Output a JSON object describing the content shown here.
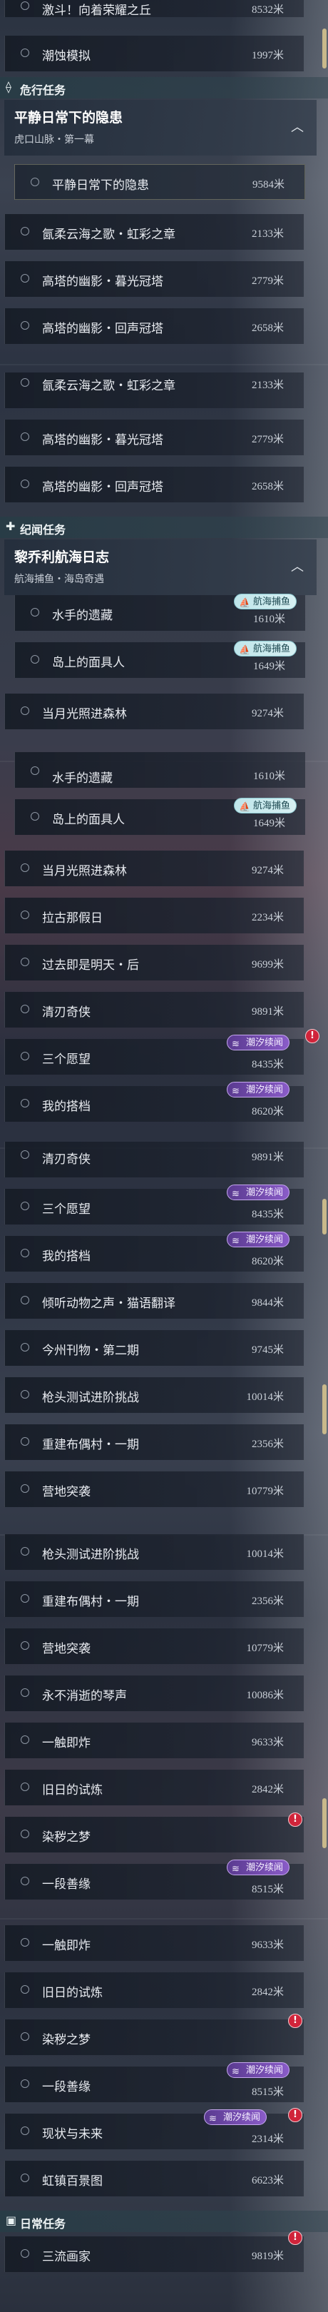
{
  "sections": {
    "danger": "危行任务",
    "legend": "纪闻任务",
    "daily": "日常任务"
  },
  "top": {
    "name": "激斗！向着荣耀之丘",
    "dist": "8532米"
  },
  "tasks": {
    "chaoshi": {
      "name": "潮蚀模拟",
      "dist": "1997米"
    },
    "pingjing": {
      "name": "平静日常下的隐患",
      "dist": "9584米"
    },
    "tingrou": {
      "name": "氤柔云海之歌・虹彩之章",
      "dist": "2133米"
    },
    "mu": {
      "name": "高塔的幽影・暮光冠塔",
      "dist": "2779米"
    },
    "hui": {
      "name": "高塔的幽影・回声冠塔",
      "dist": "2658米"
    },
    "shuishou": {
      "name": "水手的遗藏",
      "dist": "1610米"
    },
    "daoshang": {
      "name": "岛上的面具人",
      "dist": "1649米"
    },
    "dangyue": {
      "name": "当月光照进森林",
      "dist": "9274米"
    },
    "lagu": {
      "name": "拉古那假日",
      "dist": "2234米"
    },
    "guoqu": {
      "name": "过去即是明天・后",
      "dist": "9699米"
    },
    "qingren": {
      "name": "清刃奇侠",
      "dist": "9891米"
    },
    "sange": {
      "name": "三个愿望",
      "dist": "8435米"
    },
    "dada": {
      "name": "我的搭档",
      "dist": "8620米"
    },
    "qingting": {
      "name": "倾听动物之声・猫语翻译",
      "dist": "9844米"
    },
    "jinzhou": {
      "name": "今州刊物・第二期",
      "dist": "9745米"
    },
    "qiangtou": {
      "name": "枪头测试进阶挑战",
      "dist": "10014米"
    },
    "chongjian": {
      "name": "重建布偶村・一期",
      "dist": "2356米"
    },
    "yingdi": {
      "name": "营地突袭",
      "dist": "10779米"
    },
    "yongbu": {
      "name": "永不消逝的琴声",
      "dist": "10086米"
    },
    "yichu": {
      "name": "一触即炸",
      "dist": "9633米"
    },
    "jiuri": {
      "name": "旧日的试炼",
      "dist": "2842米"
    },
    "ranyi": {
      "name": "染秽之梦",
      "dist": ""
    },
    "yiduan": {
      "name": "一段善缘",
      "dist": "8515米"
    },
    "xianzhuang": {
      "name": "现状与未来",
      "dist": "2314米"
    },
    "hongzhen": {
      "name": "虹镇百景图",
      "dist": "6623米"
    },
    "sanliu": {
      "name": "三流画家",
      "dist": "9819米"
    }
  },
  "groups": {
    "pingjing": {
      "title": "平静日常下的隐患",
      "sub": "虎口山脉・第一幕"
    },
    "liqiao": {
      "title": "黎乔利航海日志",
      "sub": "航海捕鱼・海岛奇遇"
    }
  },
  "badges": {
    "hai": "航海捕鱼",
    "chao": "潮汐续闻"
  },
  "alert_symbol": "!",
  "chevron_up": "︿",
  "colors": {
    "accent": "#c9b98b",
    "alert": "#d0243a",
    "badge_hai": "#bfe5ea",
    "badge_chao": "#7a4fb8"
  }
}
